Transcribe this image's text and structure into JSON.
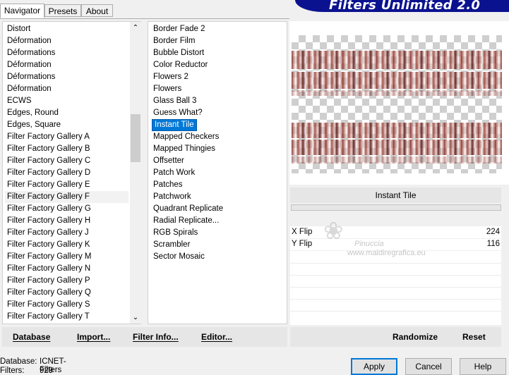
{
  "tabs": [
    "Navigator",
    "Presets",
    "About"
  ],
  "banner_title": "Filters Unlimited 2.0",
  "categories": [
    "Distort",
    "Déformation",
    "Déformations",
    "Déformation",
    "Déformations",
    "Déformation",
    "ECWS",
    "Edges, Round",
    "Edges, Square",
    "Filter Factory Gallery A",
    "Filter Factory Gallery B",
    "Filter Factory Gallery C",
    "Filter Factory Gallery D",
    "Filter Factory Gallery E",
    "Filter Factory Gallery F",
    "Filter Factory Gallery G",
    "Filter Factory Gallery H",
    "Filter Factory Gallery J",
    "Filter Factory Gallery K",
    "Filter Factory Gallery M",
    "Filter Factory Gallery N",
    "Filter Factory Gallery P",
    "Filter Factory Gallery Q",
    "Filter Factory Gallery S",
    "Filter Factory Gallery T"
  ],
  "selected_category": "Filter Factory Gallery F",
  "filters": [
    "Border Fade 2",
    "Border Film",
    "Bubble Distort",
    "Color Reductor",
    "Flowers 2",
    "Flowers",
    "Glass Ball 3",
    "Guess What?",
    "Instant Tile",
    "Mapped Checkers",
    "Mapped Thingies",
    "Offsetter",
    "Patch Work",
    "Patches",
    "Patchwork",
    "Quadrant Replicate",
    "Radial Replicate...",
    "RGB Spirals",
    "Scrambler",
    "Sector Mosaic"
  ],
  "selected_filter": "Instant Tile",
  "filter_name_display": "Instant Tile",
  "params": [
    {
      "label": "X Flip",
      "value": "224"
    },
    {
      "label": "Y Flip",
      "value": "116"
    }
  ],
  "watermark": {
    "name": "Pinuccia",
    "url": "www.maldiregrafica.eu"
  },
  "left_buttons": [
    "Database",
    "Import...",
    "Filter Info...",
    "Editor..."
  ],
  "right_buttons": [
    "Randomize",
    "Reset"
  ],
  "status": {
    "database_label": "Database:",
    "database_value": "ICNET-Filters",
    "filters_label": "Filters:",
    "filters_value": "929"
  },
  "dialog_buttons": {
    "apply": "Apply",
    "cancel": "Cancel",
    "help": "Help"
  },
  "scroll": {
    "up_glyph": "⌃",
    "down_glyph": "⌄"
  }
}
